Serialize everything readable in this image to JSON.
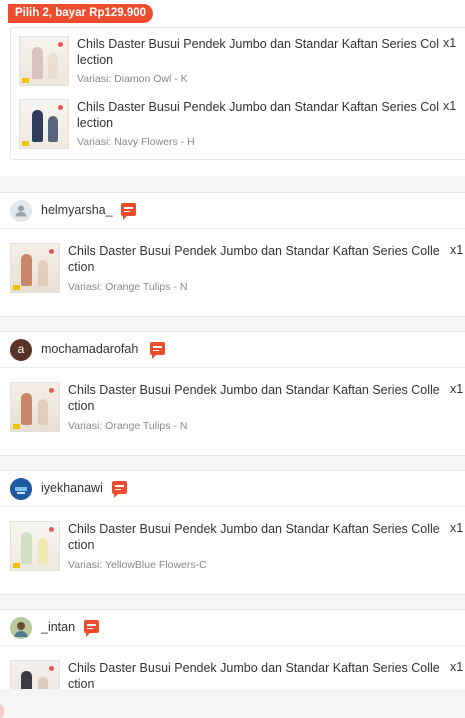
{
  "bundle": {
    "tag": "Pilih 2, bayar Rp129.900",
    "items": [
      {
        "title": "Chils Daster Busui Pendek Jumbo dan Standar Kaftan Series Collection",
        "qty": "x1",
        "variant": "Variasi: Diamon Owl - K"
      },
      {
        "title": "Chils Daster Busui Pendek Jumbo dan Standar Kaftan Series Collection",
        "qty": "x1",
        "variant": "Variasi: Navy Flowers - H"
      }
    ]
  },
  "orders": [
    {
      "username": "helmyarsha_",
      "title": "Chils Daster Busui Pendek Jumbo dan Standar Kaftan Series Collection",
      "qty": "x1",
      "variant": "Variasi: Orange Tulips - N"
    },
    {
      "username": "mochamadarofah",
      "avatar_letter": "a",
      "title": "Chils Daster Busui Pendek Jumbo dan Standar Kaftan Series Collection",
      "qty": "x1",
      "variant": "Variasi: Orange Tulips - N"
    },
    {
      "username": "iyekhanawi",
      "title": "Chils Daster Busui Pendek Jumbo dan Standar Kaftan Series Collection",
      "qty": "x1",
      "variant": "Variasi: YellowBlue Flowers-C"
    },
    {
      "username": "_intan",
      "title": "Chils Daster Busui Pendek Jumbo dan Standar Kaftan Series Collection",
      "qty": "x1",
      "variant": ""
    }
  ],
  "icons": {
    "chat": "chat-bubble-icon",
    "default_avatar": "user-silhouette-icon"
  },
  "colors": {
    "accent": "#ee4d2d",
    "muted_text": "#888888",
    "divider": "#e8e8e8"
  }
}
